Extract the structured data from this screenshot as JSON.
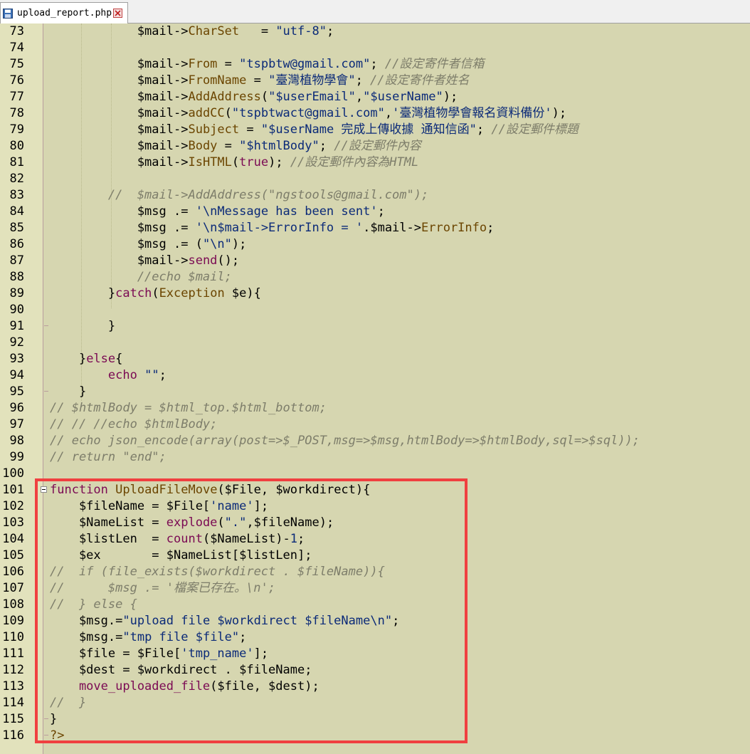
{
  "tab": {
    "filename": "upload_report.php",
    "icon": "save-file-icon",
    "close_icon": "close-icon"
  },
  "colors": {
    "keyword": "#7b0a53",
    "function": "#6b4500",
    "string": "#0b2a78",
    "comment": "#7d7d6a",
    "highlight_box": "#f04040"
  },
  "lines": [
    {
      "n": "73",
      "tokens": [
        [
          "v",
          "            $mail->"
        ],
        [
          "f",
          "CharSet"
        ],
        [
          "v",
          "   = "
        ],
        [
          "s",
          "\"utf-8\""
        ],
        [
          "v",
          ";"
        ]
      ]
    },
    {
      "n": "74",
      "tokens": []
    },
    {
      "n": "75",
      "tokens": [
        [
          "v",
          "            $mail->"
        ],
        [
          "f",
          "From"
        ],
        [
          "v",
          " = "
        ],
        [
          "s",
          "\"tspbtw@gmail.com\""
        ],
        [
          "v",
          "; "
        ],
        [
          "c",
          "//設定寄件者信箱"
        ]
      ]
    },
    {
      "n": "76",
      "tokens": [
        [
          "v",
          "            $mail->"
        ],
        [
          "f",
          "FromName"
        ],
        [
          "v",
          " = "
        ],
        [
          "s",
          "\"臺灣植物學會\""
        ],
        [
          "v",
          "; "
        ],
        [
          "c",
          "//設定寄件者姓名"
        ]
      ]
    },
    {
      "n": "77",
      "tokens": [
        [
          "v",
          "            $mail->"
        ],
        [
          "f",
          "AddAddress"
        ],
        [
          "v",
          "("
        ],
        [
          "s",
          "\"$userEmail\""
        ],
        [
          "v",
          ","
        ],
        [
          "s",
          "\"$userName\""
        ],
        [
          "v",
          ");"
        ]
      ]
    },
    {
      "n": "78",
      "tokens": [
        [
          "v",
          "            $mail->"
        ],
        [
          "f",
          "addCC"
        ],
        [
          "v",
          "("
        ],
        [
          "s",
          "\"tspbtwact@gmail.com\""
        ],
        [
          "v",
          ","
        ],
        [
          "s",
          "'臺灣植物學會報名資料備份'"
        ],
        [
          "v",
          ");"
        ]
      ]
    },
    {
      "n": "79",
      "tokens": [
        [
          "v",
          "            $mail->"
        ],
        [
          "f",
          "Subject"
        ],
        [
          "v",
          " = "
        ],
        [
          "s",
          "\"$userName 完成上傳收據 通知信函\""
        ],
        [
          "v",
          "; "
        ],
        [
          "c",
          "//設定郵件標題"
        ]
      ]
    },
    {
      "n": "80",
      "tokens": [
        [
          "v",
          "            $mail->"
        ],
        [
          "f",
          "Body"
        ],
        [
          "v",
          " = "
        ],
        [
          "s",
          "\"$htmlBody\""
        ],
        [
          "v",
          "; "
        ],
        [
          "c",
          "//設定郵件內容"
        ]
      ]
    },
    {
      "n": "81",
      "tokens": [
        [
          "v",
          "            $mail->"
        ],
        [
          "f",
          "IsHTML"
        ],
        [
          "v",
          "("
        ],
        [
          "k",
          "true"
        ],
        [
          "v",
          "); "
        ],
        [
          "c",
          "//設定郵件內容為HTML"
        ]
      ]
    },
    {
      "n": "82",
      "tokens": []
    },
    {
      "n": "83",
      "tokens": [
        [
          "c",
          "        //  $mail->AddAddress(\"ngstools@gmail.com\");"
        ]
      ]
    },
    {
      "n": "84",
      "tokens": [
        [
          "v",
          "            $msg .= "
        ],
        [
          "s",
          "'\\nMessage has been sent'"
        ],
        [
          "v",
          ";"
        ]
      ]
    },
    {
      "n": "85",
      "tokens": [
        [
          "v",
          "            $msg .= "
        ],
        [
          "s",
          "'\\n$mail->ErrorInfo = '"
        ],
        [
          "v",
          ".$mail->"
        ],
        [
          "f",
          "ErrorInfo"
        ],
        [
          "v",
          ";"
        ]
      ]
    },
    {
      "n": "86",
      "tokens": [
        [
          "v",
          "            $msg .= ("
        ],
        [
          "s",
          "\"\\n\""
        ],
        [
          "v",
          ");"
        ]
      ]
    },
    {
      "n": "87",
      "tokens": [
        [
          "v",
          "            $mail->"
        ],
        [
          "k",
          "send"
        ],
        [
          "v",
          "();"
        ]
      ]
    },
    {
      "n": "88",
      "tokens": [
        [
          "c",
          "            //echo $mail;"
        ]
      ]
    },
    {
      "n": "89",
      "tokens": [
        [
          "v",
          "        }"
        ],
        [
          "k",
          "catch"
        ],
        [
          "v",
          "("
        ],
        [
          "f",
          "Exception"
        ],
        [
          "v",
          " $e){"
        ]
      ]
    },
    {
      "n": "90",
      "tokens": []
    },
    {
      "n": "91",
      "tokens": [
        [
          "v",
          "        }"
        ]
      ]
    },
    {
      "n": "92",
      "tokens": []
    },
    {
      "n": "93",
      "tokens": [
        [
          "v",
          "    }"
        ],
        [
          "k",
          "else"
        ],
        [
          "v",
          "{"
        ]
      ]
    },
    {
      "n": "94",
      "tokens": [
        [
          "k",
          "        echo"
        ],
        [
          "v",
          " "
        ],
        [
          "s",
          "\"\""
        ],
        [
          "v",
          ";"
        ]
      ]
    },
    {
      "n": "95",
      "tokens": [
        [
          "v",
          "    }"
        ]
      ]
    },
    {
      "n": "96",
      "tokens": [
        [
          "c",
          "// $htmlBody = $html_top.$html_bottom;"
        ]
      ]
    },
    {
      "n": "97",
      "tokens": [
        [
          "c",
          "// // //echo $htmlBody;"
        ]
      ]
    },
    {
      "n": "98",
      "tokens": [
        [
          "c",
          "// echo json_encode(array(post=>$_POST,msg=>$msg,htmlBody=>$htmlBody,sql=>$sql));"
        ]
      ]
    },
    {
      "n": "99",
      "tokens": [
        [
          "c",
          "// return \"end\";"
        ]
      ]
    },
    {
      "n": "100",
      "tokens": []
    },
    {
      "n": "101",
      "tokens": [
        [
          "k",
          "function"
        ],
        [
          "v",
          " "
        ],
        [
          "f",
          "UploadFileMove"
        ],
        [
          "v",
          "($File, $workdirect){"
        ]
      ]
    },
    {
      "n": "102",
      "tokens": [
        [
          "v",
          "    $fileName = $File["
        ],
        [
          "s",
          "'name'"
        ],
        [
          "v",
          "];"
        ]
      ]
    },
    {
      "n": "103",
      "tokens": [
        [
          "v",
          "    $NameList = "
        ],
        [
          "k",
          "explode"
        ],
        [
          "v",
          "("
        ],
        [
          "s",
          "\".\""
        ],
        [
          "v",
          ",$fileName);"
        ]
      ]
    },
    {
      "n": "104",
      "tokens": [
        [
          "v",
          "    $listLen  = "
        ],
        [
          "k",
          "count"
        ],
        [
          "v",
          "($NameList)-"
        ],
        [
          "s",
          "1"
        ],
        [
          "v",
          ";"
        ]
      ]
    },
    {
      "n": "105",
      "tokens": [
        [
          "v",
          "    $ex       = $NameList[$listLen];"
        ]
      ]
    },
    {
      "n": "106",
      "tokens": [
        [
          "c",
          "//  if (file_exists($workdirect . $fileName)){"
        ]
      ]
    },
    {
      "n": "107",
      "tokens": [
        [
          "c",
          "//      $msg .= '檔案已存在。\\n';"
        ]
      ]
    },
    {
      "n": "108",
      "tokens": [
        [
          "c",
          "//  } else {"
        ]
      ]
    },
    {
      "n": "109",
      "tokens": [
        [
          "v",
          "    $msg."
        ],
        [
          "v",
          "="
        ],
        [
          "s",
          "\"upload file $workdirect $fileName\\n\""
        ],
        [
          "v",
          ";"
        ]
      ]
    },
    {
      "n": "110",
      "tokens": [
        [
          "v",
          "    $msg."
        ],
        [
          "v",
          "="
        ],
        [
          "s",
          "\"tmp file $file\""
        ],
        [
          "v",
          ";"
        ]
      ]
    },
    {
      "n": "111",
      "tokens": [
        [
          "v",
          "    $file = $File["
        ],
        [
          "s",
          "'tmp_name'"
        ],
        [
          "v",
          "];"
        ]
      ]
    },
    {
      "n": "112",
      "tokens": [
        [
          "v",
          "    $dest = $workdirect . $fileName;"
        ]
      ]
    },
    {
      "n": "113",
      "tokens": [
        [
          "k",
          "    move_uploaded_file"
        ],
        [
          "v",
          "($file, $dest);"
        ]
      ]
    },
    {
      "n": "114",
      "tokens": [
        [
          "c",
          "//  }"
        ]
      ]
    },
    {
      "n": "115",
      "tokens": [
        [
          "v",
          "}"
        ]
      ]
    },
    {
      "n": "116",
      "tokens": [
        [
          "f",
          "?>"
        ]
      ]
    }
  ]
}
